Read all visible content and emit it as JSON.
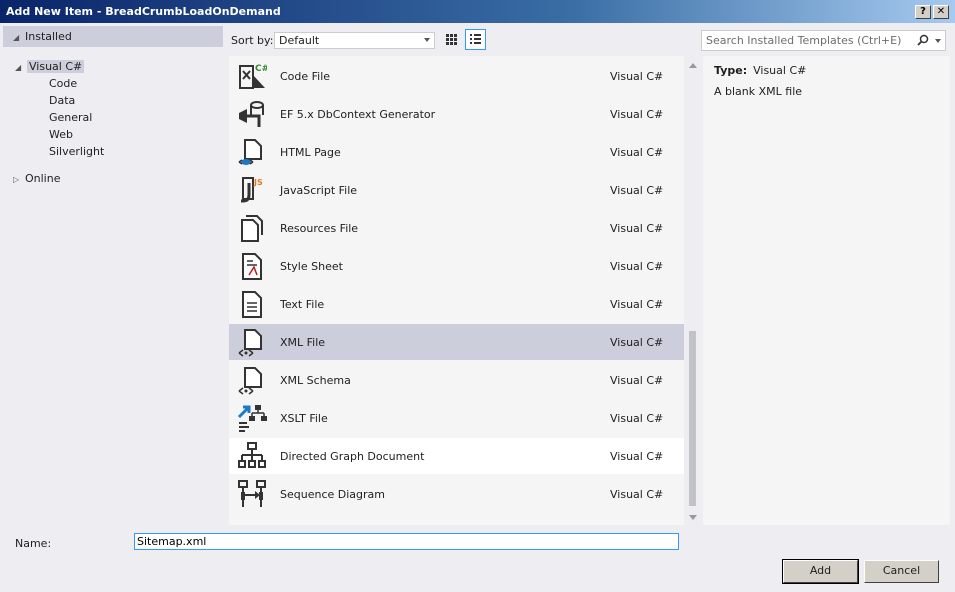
{
  "window": {
    "title": "Add New Item - BreadCrumbLoadOnDemand",
    "help_label": "?",
    "close_label": "✕"
  },
  "tree": {
    "installed_label": "Installed",
    "root_label": "Visual C#",
    "children": [
      "Code",
      "Data",
      "General",
      "Web",
      "Silverlight"
    ],
    "online_label": "Online"
  },
  "toolbar": {
    "sort_label": "Sort by:",
    "sort_value": "Default",
    "search_placeholder": "Search Installed Templates (Ctrl+E)"
  },
  "templates": [
    {
      "name": "Code File",
      "lang": "Visual C#",
      "icon": "code-file-icon"
    },
    {
      "name": "EF 5.x DbContext Generator",
      "lang": "Visual C#",
      "icon": "ef-generator-icon"
    },
    {
      "name": "HTML Page",
      "lang": "Visual C#",
      "icon": "html-page-icon"
    },
    {
      "name": "JavaScript File",
      "lang": "Visual C#",
      "icon": "javascript-file-icon"
    },
    {
      "name": "Resources File",
      "lang": "Visual C#",
      "icon": "resources-file-icon"
    },
    {
      "name": "Style Sheet",
      "lang": "Visual C#",
      "icon": "style-sheet-icon"
    },
    {
      "name": "Text File",
      "lang": "Visual C#",
      "icon": "text-file-icon"
    },
    {
      "name": "XML File",
      "lang": "Visual C#",
      "icon": "xml-file-icon"
    },
    {
      "name": "XML Schema",
      "lang": "Visual C#",
      "icon": "xml-schema-icon"
    },
    {
      "name": "XSLT File",
      "lang": "Visual C#",
      "icon": "xslt-file-icon"
    },
    {
      "name": "Directed Graph Document",
      "lang": "Visual C#",
      "icon": "directed-graph-icon"
    },
    {
      "name": "Sequence Diagram",
      "lang": "Visual C#",
      "icon": "sequence-diagram-icon"
    }
  ],
  "selected_index": 7,
  "details": {
    "type_label": "Type:",
    "type_value": "Visual C#",
    "description": "A blank XML file"
  },
  "bottom": {
    "name_label": "Name:",
    "name_value": "Sitemap.xml",
    "add_label": "Add",
    "cancel_label": "Cancel"
  },
  "colors": {
    "selection": "#cccedb",
    "accent": "#3399ff"
  }
}
